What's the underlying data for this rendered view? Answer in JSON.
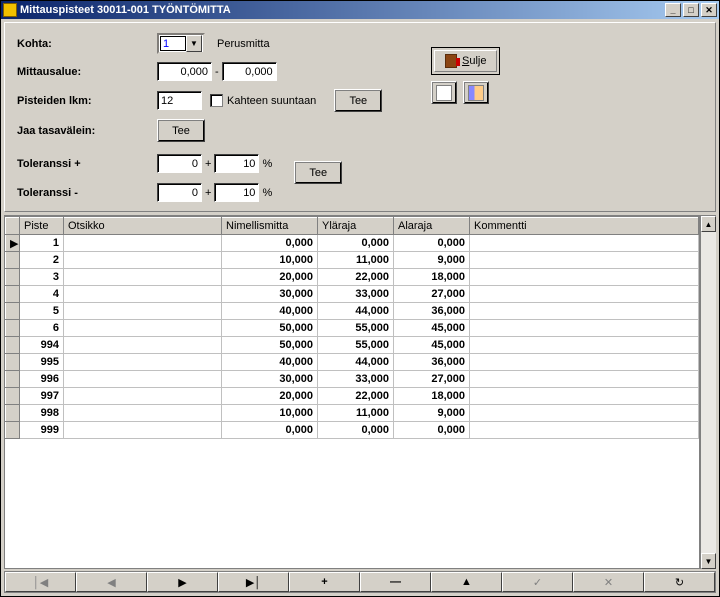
{
  "window": {
    "title": "Mittauspisteet 30011-001 TYÖNTÖMITTA"
  },
  "labels": {
    "kohta": "Kohta:",
    "perusmitta": "Perusmitta",
    "mittausalue": "Mittausalue:",
    "pisteiden": "Pisteiden lkm:",
    "kahteen": "Kahteen suuntaan",
    "jaa": "Jaa tasavälein:",
    "tolp": "Toleranssi +",
    "tolm": "Toleranssi -",
    "sep": "-",
    "plus": "+",
    "pct": "%",
    "sulje": "Sulje"
  },
  "values": {
    "kohta": "1",
    "range_from": "0,000",
    "range_to": "0,000",
    "pisteiden": "12",
    "tolp_a": "0",
    "tolp_b": "10",
    "tolm_a": "0",
    "tolm_b": "10"
  },
  "buttons": {
    "tee": "Tee"
  },
  "grid": {
    "headers": {
      "piste": "Piste",
      "otsikko": "Otsikko",
      "nimellis": "Nimellismitta",
      "ylaraja": "Yläraja",
      "alaraja": "Alaraja",
      "kommentti": "Kommentti"
    },
    "rows": [
      {
        "piste": "1",
        "otsikko": "",
        "nimellis": "0,000",
        "ylaraja": "0,000",
        "alaraja": "0,000",
        "kommentti": ""
      },
      {
        "piste": "2",
        "otsikko": "",
        "nimellis": "10,000",
        "ylaraja": "11,000",
        "alaraja": "9,000",
        "kommentti": ""
      },
      {
        "piste": "3",
        "otsikko": "",
        "nimellis": "20,000",
        "ylaraja": "22,000",
        "alaraja": "18,000",
        "kommentti": ""
      },
      {
        "piste": "4",
        "otsikko": "",
        "nimellis": "30,000",
        "ylaraja": "33,000",
        "alaraja": "27,000",
        "kommentti": ""
      },
      {
        "piste": "5",
        "otsikko": "",
        "nimellis": "40,000",
        "ylaraja": "44,000",
        "alaraja": "36,000",
        "kommentti": ""
      },
      {
        "piste": "6",
        "otsikko": "",
        "nimellis": "50,000",
        "ylaraja": "55,000",
        "alaraja": "45,000",
        "kommentti": ""
      },
      {
        "piste": "994",
        "otsikko": "",
        "nimellis": "50,000",
        "ylaraja": "55,000",
        "alaraja": "45,000",
        "kommentti": ""
      },
      {
        "piste": "995",
        "otsikko": "",
        "nimellis": "40,000",
        "ylaraja": "44,000",
        "alaraja": "36,000",
        "kommentti": ""
      },
      {
        "piste": "996",
        "otsikko": "",
        "nimellis": "30,000",
        "ylaraja": "33,000",
        "alaraja": "27,000",
        "kommentti": ""
      },
      {
        "piste": "997",
        "otsikko": "",
        "nimellis": "20,000",
        "ylaraja": "22,000",
        "alaraja": "18,000",
        "kommentti": ""
      },
      {
        "piste": "998",
        "otsikko": "",
        "nimellis": "10,000",
        "ylaraja": "11,000",
        "alaraja": "9,000",
        "kommentti": ""
      },
      {
        "piste": "999",
        "otsikko": "",
        "nimellis": "0,000",
        "ylaraja": "0,000",
        "alaraja": "0,000",
        "kommentti": ""
      }
    ]
  },
  "nav": {
    "first": "⏮",
    "prev": "◀",
    "next": "▶",
    "last": "▶│",
    "add": "✚",
    "remove": "—",
    "up": "▲",
    "check": "✓",
    "cancel": "✕",
    "refresh": "↻"
  }
}
